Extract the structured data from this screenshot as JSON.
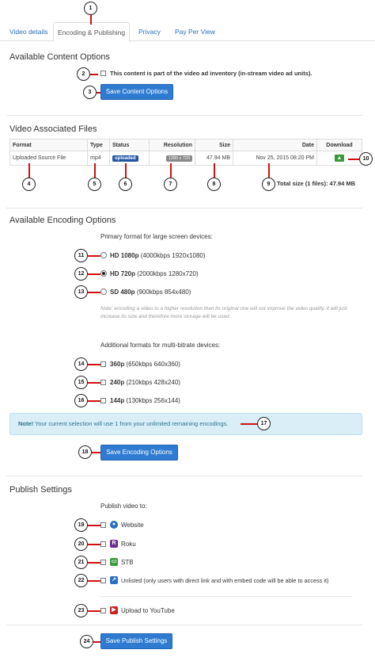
{
  "tabs": [
    {
      "label": "Video details"
    },
    {
      "label": "Encoding & Publishing"
    },
    {
      "label": "Privacy"
    },
    {
      "label": "Pay Per View"
    }
  ],
  "content_options": {
    "title": "Available Content Options",
    "checkbox_label": "This content is part of the video ad inventory (in-stream video ad units).",
    "save_button": "Save Content Options"
  },
  "files": {
    "title": "Video Associated Files",
    "headers": [
      "Format",
      "Type",
      "Status",
      "Resolution",
      "Size",
      "Date",
      "Download"
    ],
    "row": {
      "format": "Uploaded Source File",
      "type": "mp4",
      "status": "uploaded",
      "resolution": "1280 x 720",
      "size": "47.94 MB",
      "date": "Nov 25, 2015 08:20 PM"
    },
    "total": "Total size (1 files): 47.94 MB"
  },
  "encoding": {
    "title": "Available Encoding Options",
    "primary_label": "Primary format for large screen devices:",
    "options": [
      {
        "name": "HD 1080p",
        "detail": "(4000kbps 1920x1080)",
        "selected": false
      },
      {
        "name": "HD 720p",
        "detail": "(2000kbps 1280x720)",
        "selected": true
      },
      {
        "name": "SD 480p",
        "detail": "(900kbps 854x480)",
        "selected": false
      }
    ],
    "note": "Note: encoding a video to a higher resolution than its original one will not improve the video quality, it will just increase its size and therefore more storage will be used.",
    "additional_label": "Additional formats for multi-bitrate devices:",
    "additional": [
      {
        "name": "360p",
        "detail": "(650kbps 640x360)"
      },
      {
        "name": "240p",
        "detail": "(210kbps 428x240)"
      },
      {
        "name": "144p",
        "detail": "(130kbps 256x144)"
      }
    ],
    "alert_strong": "Note!",
    "alert_text": " Your current selection will use 1 from your unlimited remaining encodings.",
    "save_button": "Save Encoding Options"
  },
  "publish": {
    "title": "Publish Settings",
    "label": "Publish video to:",
    "targets": [
      {
        "label": "Website",
        "icon": "website-icon",
        "color": "#2a6fc0"
      },
      {
        "label": "Roku",
        "icon": "roku-icon",
        "color": "#6a2c91"
      },
      {
        "label": "STB",
        "icon": "stb-icon",
        "color": "#3a9a3a"
      },
      {
        "label": "Unlisted (only users with direct link and with embed code will be able to access it)",
        "icon": "unlisted-icon",
        "color": "#2a6fc0"
      },
      {
        "label": "Upload to YouTube",
        "icon": "youtube-icon",
        "color": "#cc2020"
      }
    ],
    "save_button": "Save Publish Settings"
  },
  "callouts": [
    "1",
    "2",
    "3",
    "4",
    "5",
    "6",
    "7",
    "8",
    "9",
    "10",
    "11",
    "12",
    "13",
    "14",
    "15",
    "16",
    "17",
    "18",
    "19",
    "20",
    "21",
    "22",
    "23",
    "24"
  ]
}
